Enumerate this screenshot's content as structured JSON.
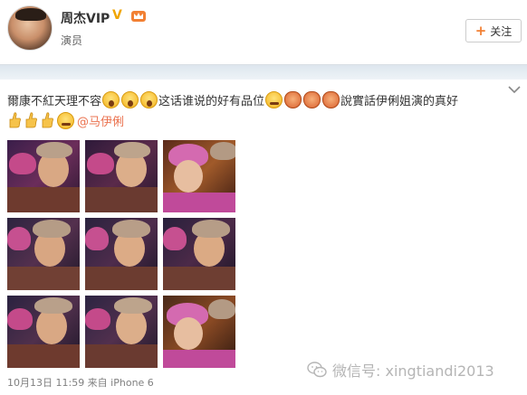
{
  "profile": {
    "name": "周杰VIP",
    "verified_mark": "V",
    "crown_icon": "crown-vip-icon",
    "title": "演员",
    "follow_label": "关注",
    "follow_icon": "plus-icon",
    "accent": "#f28033"
  },
  "post": {
    "menu_icon": "chevron-down-icon",
    "line1": {
      "text_a": "爾康不紅天理不容",
      "text_b": "这话谁说的好有品位",
      "text_c": "說實話伊俐姐演的真好"
    },
    "line2": {
      "mention": "@马伊俐"
    },
    "mention_color": "#eb7350",
    "photos_count_label": "",
    "footer": "10月13日 11:59 来自 iPhone 6"
  },
  "watermark": {
    "icon": "wechat-icon",
    "text": "微信号: xingtiandi2013"
  }
}
